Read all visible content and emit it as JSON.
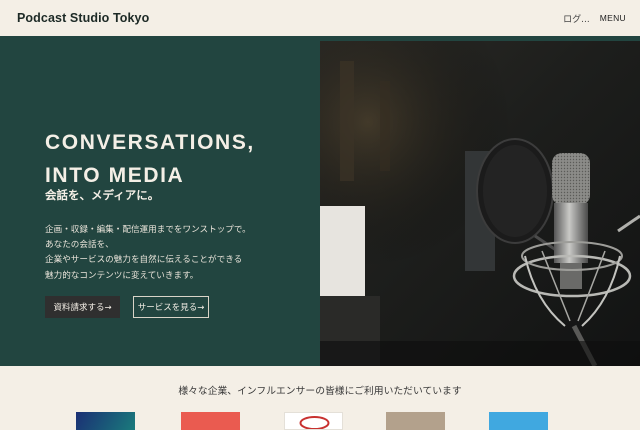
{
  "header": {
    "brand": "Podcast Studio Tokyo",
    "login_label": "ログ...",
    "menu_label": "MENU"
  },
  "hero": {
    "headline_line1": "CONVERSATIONS,",
    "headline_line2": "INTO MEDIA",
    "subhead": "会話を、メディアに。",
    "description": [
      "企画・収録・編集・配信運用までをワンストップで。",
      "あなたの会話を、",
      "企業やサービスの魅力を自然に伝えることができる",
      "魅力的なコンテンツに変えていきます。"
    ],
    "primary_button": "資料請求する→",
    "secondary_button": "サービスを見る→",
    "image": "studio-microphone-photo"
  },
  "clients": {
    "title": "様々な企業、インフルエンサーの皆様にご利用いただいています",
    "logos": [
      {
        "name": "client-logo-1",
        "color": "#1b2f74"
      },
      {
        "name": "client-logo-2",
        "color": "#ea5b50"
      },
      {
        "name": "client-logo-3",
        "color": "#ffffff"
      },
      {
        "name": "client-logo-4",
        "color": "#b3a18c"
      },
      {
        "name": "client-logo-5",
        "color": "#40a8e0"
      }
    ]
  },
  "colors": {
    "hero_bg": "#224540",
    "page_bg": "#f4efe6",
    "primary_button_bg": "#2f2f2f"
  }
}
